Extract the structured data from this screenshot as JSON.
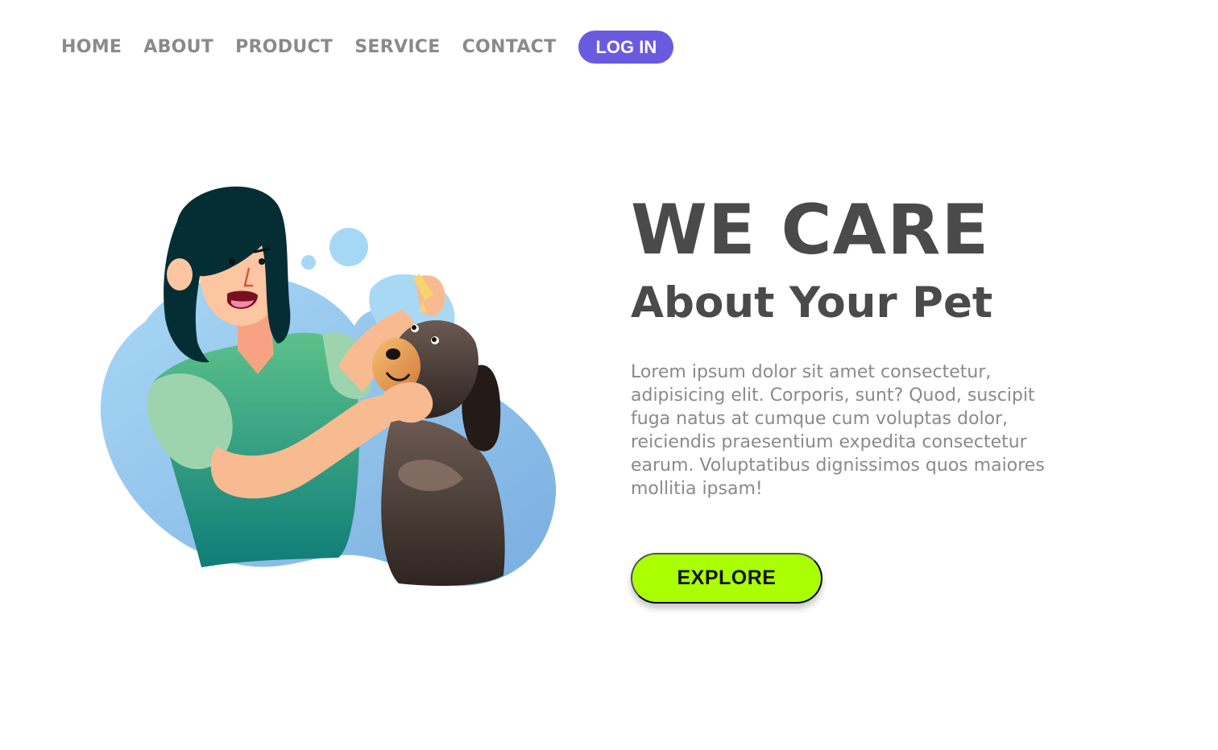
{
  "nav": {
    "items": [
      {
        "label": "HOME"
      },
      {
        "label": "ABOUT"
      },
      {
        "label": "PRODUCT"
      },
      {
        "label": "SERVICE"
      },
      {
        "label": "CONTACT"
      }
    ],
    "login_label": "LOG IN"
  },
  "hero": {
    "title": "WE CARE",
    "subtitle": "About Your Pet",
    "body": "Lorem ipsum dolor sit amet consectetur, adipisicing elit. Corporis, sunt? Quod, suscipit fuga natus at cumque cum voluptas dolor, reiciendis praesentium expedita consectetur earum. Voluptatibus dignissimos quos maiores mollitia ipsam!",
    "explore_label": "EXPLORE"
  },
  "colors": {
    "accent": "#6a5ae0",
    "button": "#aaff00",
    "heading": "#4a4a4a",
    "text": "#8a8a8a"
  }
}
